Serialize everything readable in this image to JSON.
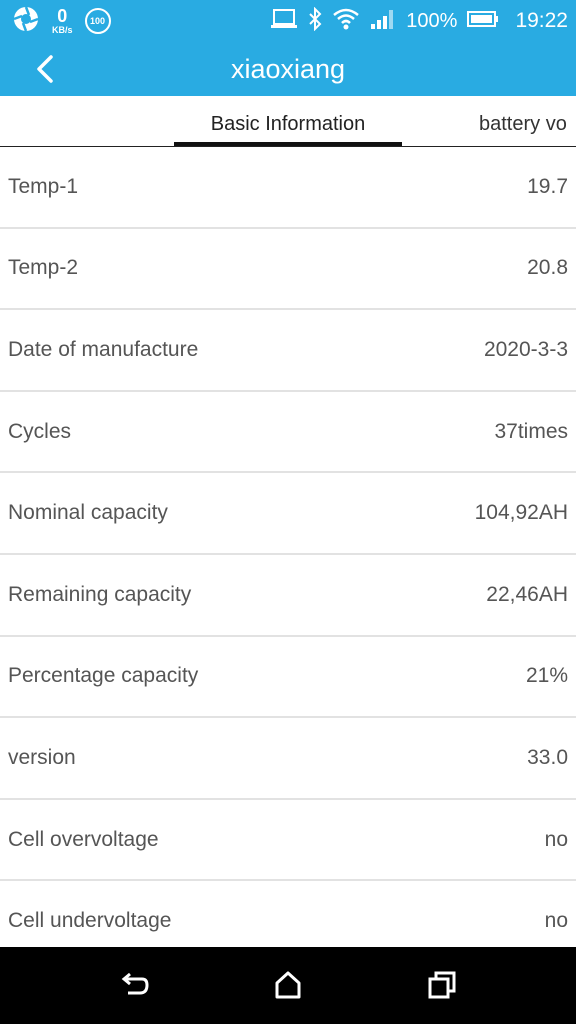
{
  "status_bar": {
    "net_speed_value": "0",
    "net_speed_unit": "KB/s",
    "badge": "100",
    "battery_percent": "100%",
    "time": "19:22",
    "icons": [
      "aperture-icon",
      "laptop-icon",
      "bluetooth-icon",
      "wifi-icon",
      "signal-icon",
      "battery-icon"
    ]
  },
  "app_bar": {
    "title": "xiaoxiang",
    "back_icon": "chevron-left-icon"
  },
  "tabs": [
    {
      "label": "Basic Information",
      "selected": true
    },
    {
      "label": "battery vo",
      "selected": false
    }
  ],
  "rows": [
    {
      "label": "Temp-1",
      "value": "19.7"
    },
    {
      "label": "Temp-2",
      "value": "20.8"
    },
    {
      "label": "Date of manufacture",
      "value": "2020-3-3"
    },
    {
      "label": "Cycles",
      "value": "37times"
    },
    {
      "label": "Nominal capacity",
      "value": "104,92AH"
    },
    {
      "label": "Remaining capacity",
      "value": "22,46AH"
    },
    {
      "label": "Percentage capacity",
      "value": "21%"
    },
    {
      "label": "version",
      "value": "33.0"
    },
    {
      "label": "Cell overvoltage",
      "value": "no"
    },
    {
      "label": "Cell undervoltage",
      "value": "no"
    }
  ],
  "nav_bar": {
    "icons": [
      "back-icon",
      "home-icon",
      "recents-icon"
    ]
  },
  "colors": {
    "accent": "#29abe2",
    "text": "#555555",
    "divider": "#e2e2e2",
    "navbar": "#000000"
  }
}
